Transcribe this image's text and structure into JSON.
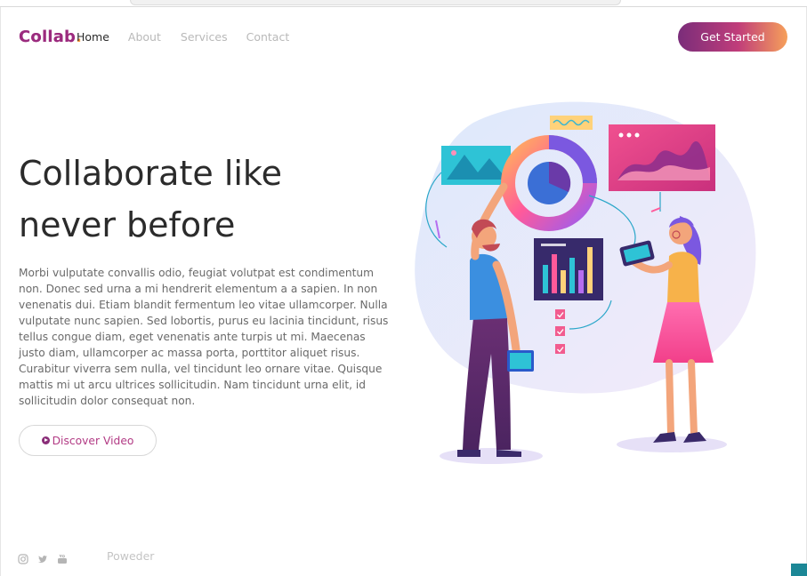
{
  "header": {
    "logo_text": "Collab",
    "logo_dot": ".",
    "nav": {
      "home": "Home",
      "about": "About",
      "services": "Services",
      "contact": "Contact"
    },
    "cta_label": "Get Started"
  },
  "hero": {
    "title_line1": "Collaborate like",
    "title_line2": "never before",
    "body": "Morbi vulputate convallis odio, feugiat volutpat est condimentum non. Donec sed urna a mi hendrerit elementum a a sapien. In non venenatis dui. Etiam blandit fermentum leo vitae ullamcorper. Nulla vulputate nunc sapien. Sed lobortis, purus eu lacinia tincidunt, risus tellus congue diam, eget venenatis ante turpis ut mi. Maecenas justo diam, ullamcorper ac massa porta, porttitor aliquet risus. Curabitur viverra sem nulla, vel tincidunt leo ornare vitae. Quisque mattis mi ut arcu ultrices sollicitudin. Nam tincidunt urna elit, id sollicitudin dolor consequat non.",
    "video_button_label": "Discover Video"
  },
  "footer": {
    "social_icons": [
      "instagram-icon",
      "twitter-icon",
      "youtube-icon"
    ],
    "text": "Poweder"
  },
  "colors": {
    "brand_purple": "#8a2d78",
    "brand_pink": "#c03d7a",
    "brand_orange": "#f6a05a",
    "link_pink": "#b23a84"
  }
}
